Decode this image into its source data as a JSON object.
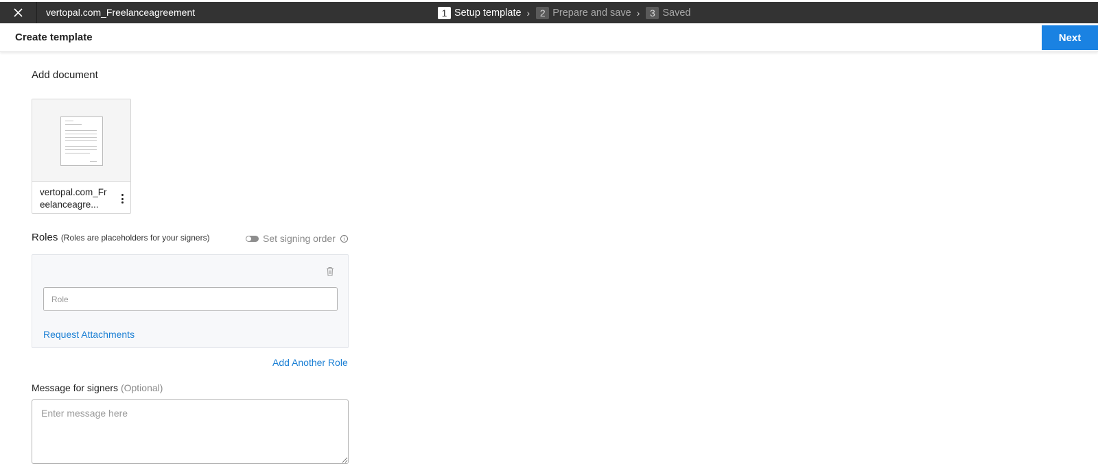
{
  "topbar": {
    "close_icon": "close-icon",
    "document_title": "vertopal.com_Freelanceagreement",
    "steps": [
      {
        "number": "1",
        "label": "Setup template",
        "state": "active"
      },
      {
        "number": "2",
        "label": "Prepare and save",
        "state": "inactive"
      },
      {
        "number": "3",
        "label": "Saved",
        "state": "inactive"
      }
    ],
    "separator": "›"
  },
  "header": {
    "title": "Create template",
    "next_label": "Next"
  },
  "document_section": {
    "heading": "Add document",
    "file_name": "vertopal.com_Freelanceagre...",
    "menu_icon": "more-vertical-icon"
  },
  "roles": {
    "label": "Roles",
    "hint": "(Roles are placeholders for your signers)",
    "signing_order_label": "Set signing order",
    "signing_order_enabled": false,
    "role_placeholder": "Role",
    "delete_icon": "trash-icon",
    "request_attachments": "Request Attachments",
    "add_another_role": "Add Another Role"
  },
  "message": {
    "label": "Message for signers",
    "optional": "(Optional)",
    "placeholder": "Enter message here"
  },
  "colors": {
    "topbar_bg": "#333333",
    "primary": "#1a82e2",
    "link": "#1a7fd4"
  }
}
